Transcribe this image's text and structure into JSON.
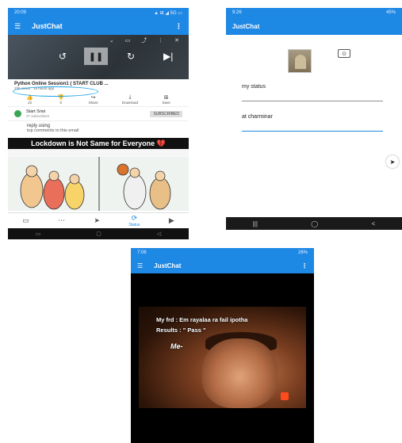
{
  "phone1": {
    "status_time": "20:09",
    "status_right": "▲ ⊞ ◢ 5G ▭",
    "app_title": "JustChat",
    "video_title": "Python Online Session1 ( START CLUB ...",
    "video_sub": "256 views · 19 hours ago",
    "actions": [
      {
        "icon": "thumbs-up-icon",
        "glyph": "👍",
        "label": "22"
      },
      {
        "icon": "thumbs-down-icon",
        "glyph": "👎",
        "label": "0"
      },
      {
        "icon": "share-icon",
        "glyph": "↪",
        "label": "Share"
      },
      {
        "icon": "download-icon",
        "glyph": "⤓",
        "label": "Download"
      },
      {
        "icon": "save-icon",
        "glyph": "⊞",
        "label": "Save"
      }
    ],
    "channel_name": "Start Srist",
    "channel_subs": "27 subscribers",
    "subscribe_label": "SUBSCRIBED",
    "comments_label": "reply using",
    "comments_sub": "top comments to this email",
    "meme_title": "Lockdown is Not Same for Everyone 💔",
    "nav": [
      {
        "icon": "chat-icon",
        "glyph": "▭",
        "label": ""
      },
      {
        "icon": "groups-icon",
        "glyph": "⋯",
        "label": ""
      },
      {
        "icon": "send-icon",
        "glyph": "➤",
        "label": ""
      },
      {
        "icon": "status-icon",
        "glyph": "⟳",
        "label": "Status"
      },
      {
        "icon": "play-icon",
        "glyph": "▶",
        "label": ""
      }
    ]
  },
  "phone2": {
    "status_time": "9:26",
    "status_right": "45%",
    "app_title": "JustChat",
    "status_field": "my status",
    "location_field": "at charminar",
    "sys_nav": [
      "|||",
      "◯",
      "<"
    ]
  },
  "phone3": {
    "status_time": "7:06",
    "status_right": "26%",
    "app_title": "JustChat",
    "meme_line1": "My  frd : Em rayalaa ra fail ipotha",
    "meme_line2": "Results : \" Pass \"",
    "meme_me": "Me-"
  }
}
